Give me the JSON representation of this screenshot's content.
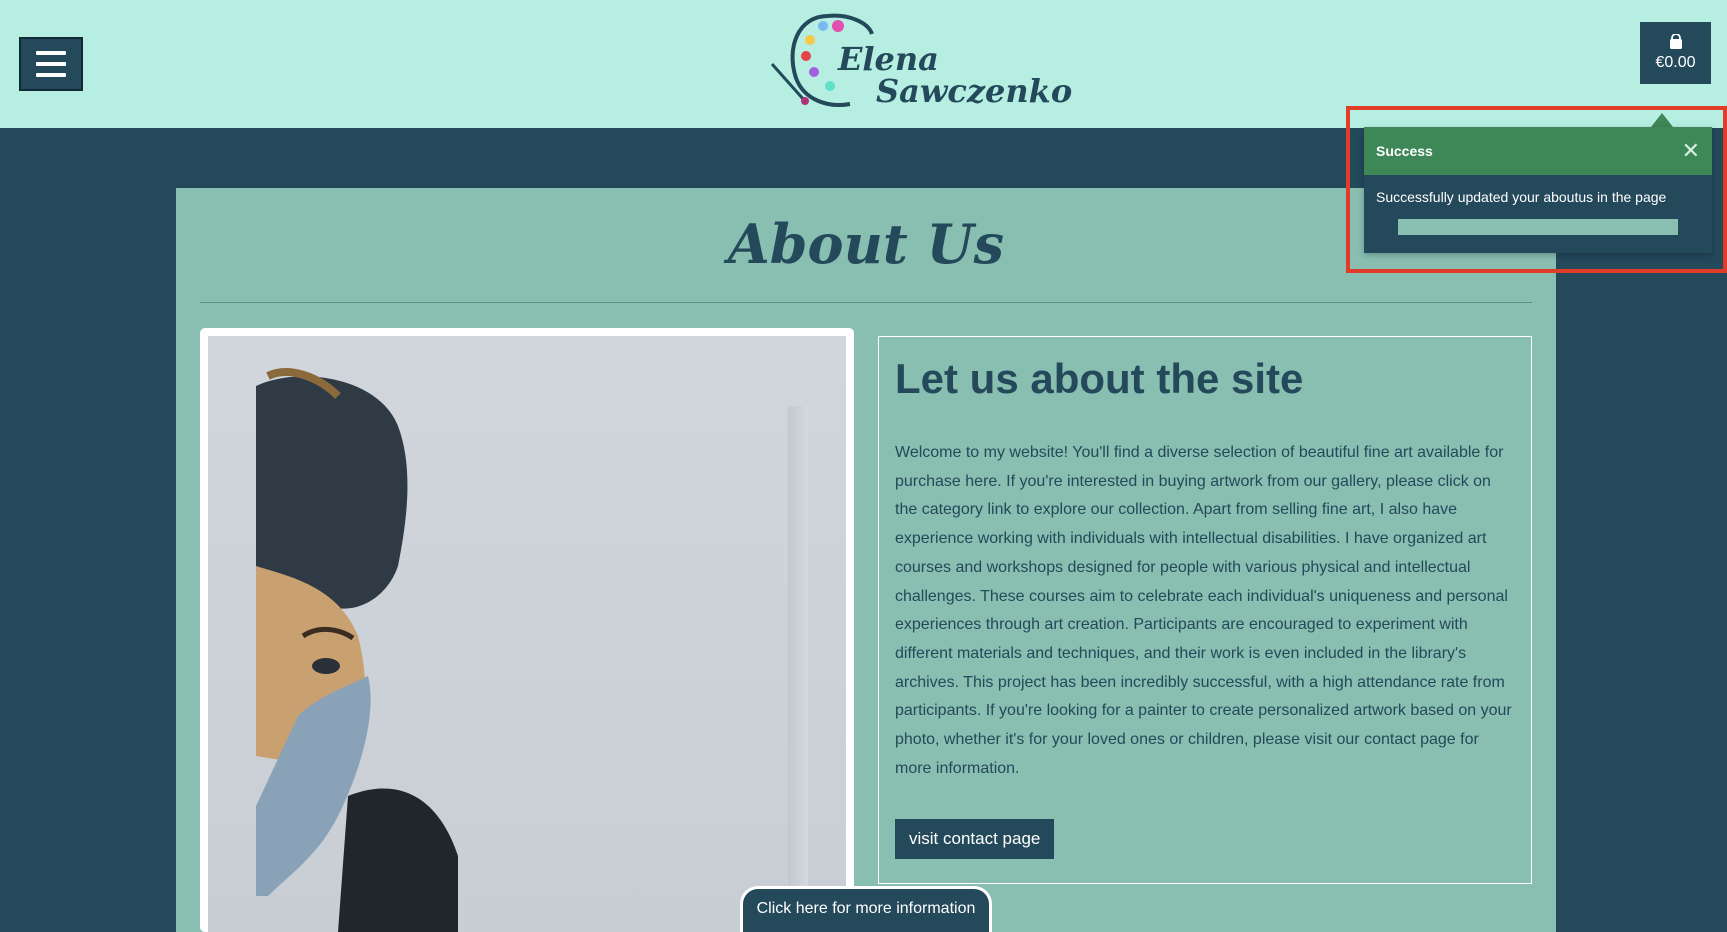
{
  "header": {
    "logo_line1": "Elena",
    "logo_line2": "Sawczenko",
    "cart_total": "€0.00"
  },
  "main": {
    "title": "About Us",
    "card_heading": "Let us about the site",
    "card_body": "Welcome to my website! You'll find a diverse selection of beautiful fine art available for purchase here. If you're interested in buying artwork from our gallery, please click on the category link to explore our collection. Apart from selling fine art, I also have experience working with individuals with intellectual disabilities. I have organized art courses and workshops designed for people with various physical and intellectual challenges. These courses aim to celebrate each individual's uniqueness and personal experiences through art creation. Participants are encouraged to experiment with different materials and techniques, and their work is even included in the library's archives. This project has been incredibly successful, with a high attendance rate from participants. If you're looking for a painter to create personalized artwork based on your photo, whether it's for your loved ones or children, please visit our contact page for more information.",
    "contact_button": "visit contact page",
    "info_button": "Click here for more information"
  },
  "toast": {
    "title": "Success",
    "message": "Successfully updated your aboutus in the page",
    "close_icon": "close-icon"
  },
  "colors": {
    "header_bg": "#b6efe2",
    "page_bg": "#23495b",
    "content_bg": "#89bfb1",
    "toast_header": "#3e8756",
    "highlight": "#e13b2a"
  }
}
